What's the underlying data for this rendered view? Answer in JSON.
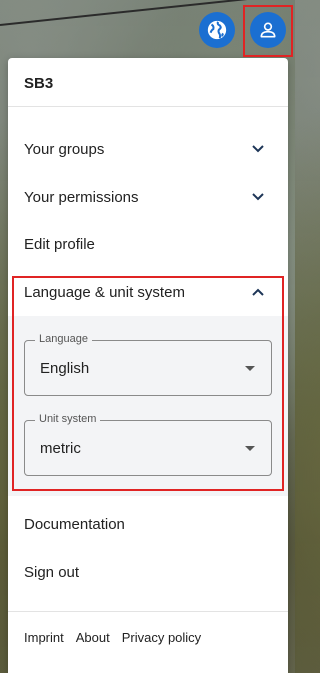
{
  "header": {
    "globe_icon": "globe-icon",
    "user_icon": "user-icon"
  },
  "panel": {
    "title": "SB3",
    "menu": {
      "groups": "Your groups",
      "permissions": "Your permissions",
      "edit_profile": "Edit profile",
      "language_unit": "Language & unit system",
      "documentation": "Documentation",
      "sign_out": "Sign out"
    },
    "language_field": {
      "label": "Language",
      "value": "English"
    },
    "unit_field": {
      "label": "Unit system",
      "value": "metric"
    },
    "footer": {
      "imprint": "Imprint",
      "about": "About",
      "privacy": "Privacy policy"
    }
  },
  "colors": {
    "accent": "#1b6fd1",
    "highlight": "#e02424",
    "section_bg": "#f3f4f6"
  }
}
